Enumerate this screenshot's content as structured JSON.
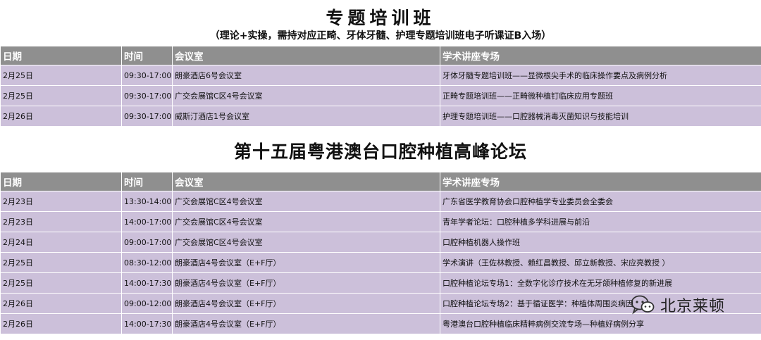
{
  "section1": {
    "title": "专题培训班",
    "subtitle": "（理论+实操，需持对应正畸、牙体牙髓、护理专题培训班电子听课证B入场）",
    "headers": [
      "日期",
      "时间",
      "会议室",
      "学术讲座专场"
    ],
    "rows": [
      [
        "2月25日",
        "09:30-17:00",
        "朗豪酒店6号会议室",
        "牙体牙髓专题培训班——显微根尖手术的临床操作要点及病例分析"
      ],
      [
        "2月25日",
        "09:30-17:00",
        "广交会展馆C区4号会议室",
        "正畸专题培训班——正畸微种植钉临床应用专题班"
      ],
      [
        "2月26日",
        "09:30-17:00",
        "威斯汀酒店1号会议室",
        "护理专题培训班——口腔器械消毒灭菌知识与技能培训"
      ]
    ]
  },
  "section2": {
    "title": "第十五届粤港澳台口腔种植高峰论坛",
    "headers": [
      "日期",
      "时间",
      "会议室",
      "学术讲座专场"
    ],
    "rows": [
      [
        "2月23日",
        "13:30-14:00",
        "广交会展馆C区4号会议室",
        "广东省医学教育协会口腔种植学专业委员会全委会"
      ],
      [
        "2月23日",
        "14:00-17:00",
        "广交会展馆C区4号会议室",
        "青年学者论坛：口腔种植多学科进展与前沿"
      ],
      [
        "2月24日",
        "09:00-17:00",
        "广交会展馆C区4号会议室",
        "口腔种植机器人操作班"
      ],
      [
        "2月25日",
        "08:30-12:00",
        "朗豪酒店4号会议室（E+F厅）",
        "学术演讲（王佐林教授、赖红昌教授、邱立新教授、宋应亮教授 ）"
      ],
      [
        "2月25日",
        "14:00-17:30",
        "朗豪酒店4号会议室（E+F厅）",
        "口腔种植论坛专场1：全数字化诊疗技术在无牙颌种植修复的新进展"
      ],
      [
        "2月26日",
        "09:00-12:00",
        "朗豪酒店4号会议室（E+F厅）",
        "口腔种植论坛专场2：基于循证医学：种植体周围炎病因"
      ],
      [
        "2月26日",
        "14:00-17:30",
        "朗豪酒店4号会议室（E+F厅）",
        "粤港澳台口腔种植临床精粹病例交流专场—种植好病例分享"
      ]
    ]
  },
  "watermark": {
    "text": "北京莱顿",
    "icon": "wechat-icon"
  }
}
